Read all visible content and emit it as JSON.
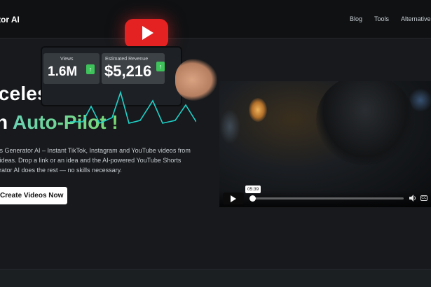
{
  "nav": {
    "brand": "tor AI",
    "links": [
      "Blog",
      "Tools",
      "Alternatives"
    ]
  },
  "hero": {
    "title_line1": "aceless Videos",
    "title_line2_prefix": "n ",
    "title_line2_accent": "Auto-Pilot",
    "title_line2_suffix": " !",
    "description_lines": [
      "rts Generator  AI – Instant TikTok, Instagram and YouTube videos from",
      "r ideas. Drop a link  or an idea and the AI-powered YouTube Shorts",
      "erator AI does the rest — no skills necessary."
    ],
    "cta_label": "Create Videos Now"
  },
  "video": {
    "views_label": "Views",
    "views_value": "1.6M",
    "revenue_label": "Estimated Revenue",
    "revenue_value": "$5,216",
    "time_tooltip": "05:39",
    "progress": 0.02,
    "cc_label": "CC",
    "colors": {
      "youtube_red": "#e52222",
      "accent_green": "#3ec35a",
      "wave_cyan": "#1fd1c9"
    }
  }
}
